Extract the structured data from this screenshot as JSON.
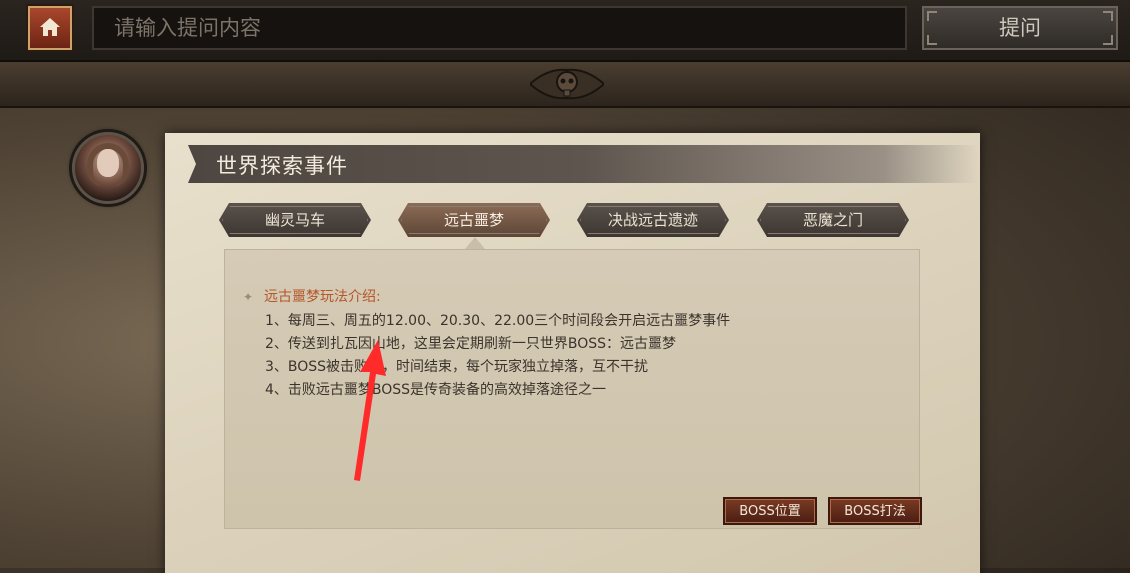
{
  "topbar": {
    "search_placeholder": "请输入提问内容",
    "ask_label": "提问"
  },
  "panel": {
    "title": "世界探索事件",
    "tabs": [
      {
        "label": "幽灵马车",
        "active": false
      },
      {
        "label": "远古噩梦",
        "active": true
      },
      {
        "label": "决战远古遗迹",
        "active": false
      },
      {
        "label": "恶魔之门",
        "active": false
      }
    ],
    "section_title": "远古噩梦玩法介绍:",
    "rules": [
      "1、每周三、周五的12.00、20.30、22.00三个时间段会开启远古噩梦事件",
      "2、传送到扎瓦因山地，这里会定期刷新一只世界BOSS：远古噩梦",
      "3、BOSS被击败后，时间结束，每个玩家独立掉落，互不干扰",
      "4、击败远古噩梦BOSS是传奇装备的高效掉落途径之一"
    ],
    "buttons": {
      "boss_location": "BOSS位置",
      "boss_strategy": "BOSS打法"
    }
  },
  "colors": {
    "accent_red": "#b5562b",
    "button_red": "#7a3a24",
    "annotation_arrow": "#ff2a2a"
  }
}
